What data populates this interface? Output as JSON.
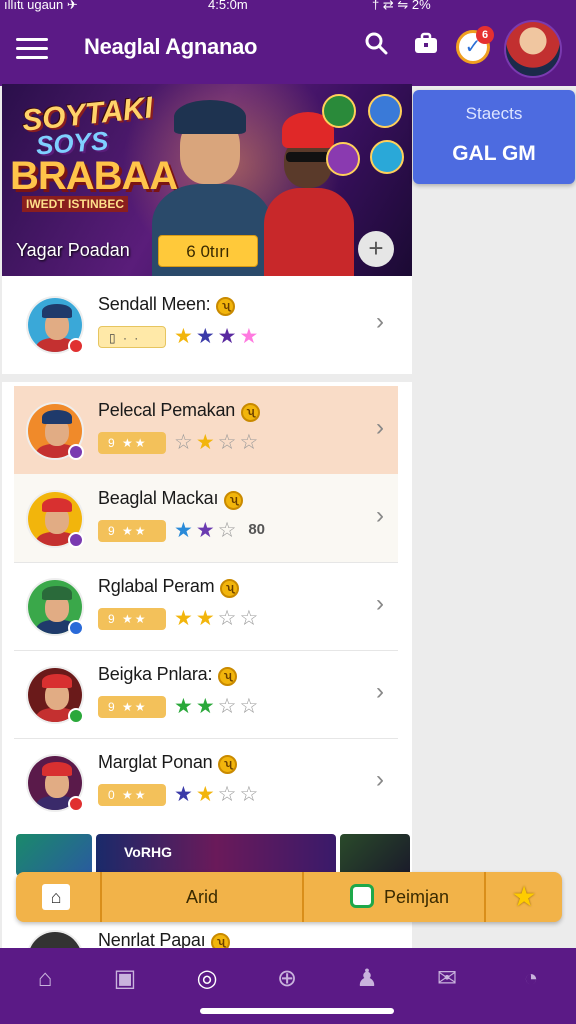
{
  "status_bar": {
    "left": "ıllıtɩ ugaun ✈",
    "time": "4:5:0m",
    "right": "† ⇄ ⇋  2%"
  },
  "header": {
    "title": "Neaglal Agnanao",
    "notification_badge": "6"
  },
  "banner": {
    "logo_line1": "SOYTAKI",
    "logo_line2": "SOYS",
    "logo_line3": "BRABAA",
    "logo_line4": "IWEDT ISTINBEC",
    "player_name": "Yagar Poadan",
    "button_label": "6 0tırı",
    "add_label": "+"
  },
  "side_panel": {
    "title": "Staects",
    "value": "GAL GM"
  },
  "players": [
    {
      "name": "Sendall Meen:",
      "pill": "▯ ·  ·",
      "stars": [
        {
          "c": "#f2b50c",
          "f": "★"
        },
        {
          "c": "#3a3aa8",
          "f": "★"
        },
        {
          "c": "#5a2aa0",
          "f": "★"
        },
        {
          "c": "#ff7ae0",
          "f": "★"
        }
      ],
      "extra": "",
      "highlight": false,
      "alt": false,
      "hat": "#1f3a6b",
      "shirt": "#c43030",
      "bg": "#3aa8d8",
      "badge": "#e03030"
    },
    {
      "name": "Pelecal Pemakan",
      "pill": "9 ★★",
      "stars": [
        {
          "c": "#999",
          "f": "☆"
        },
        {
          "c": "#f2b50c",
          "f": "★"
        },
        {
          "c": "#999",
          "f": "☆"
        },
        {
          "c": "#999",
          "f": "☆"
        }
      ],
      "extra": "",
      "highlight": true,
      "alt": false,
      "hat": "#1f3a6b",
      "shirt": "#c43030",
      "bg": "#f08a2a",
      "badge": "#7a3ab0"
    },
    {
      "name": "Beaglal Mackaı",
      "pill": "9 ★★",
      "stars": [
        {
          "c": "#2a8ad8",
          "f": "★"
        },
        {
          "c": "#6a3ab0",
          "f": "★"
        },
        {
          "c": "#999",
          "f": "☆"
        }
      ],
      "extra": "80",
      "highlight": false,
      "alt": true,
      "hat": "#d83030",
      "shirt": "#c43030",
      "bg": "#f2b50c",
      "badge": "#7a3ab0"
    },
    {
      "name": "Rglabal Peram",
      "pill": "9 ★★",
      "stars": [
        {
          "c": "#f2b50c",
          "f": "★"
        },
        {
          "c": "#f2b50c",
          "f": "★"
        },
        {
          "c": "#999",
          "f": "☆"
        },
        {
          "c": "#999",
          "f": "☆"
        }
      ],
      "extra": "",
      "highlight": false,
      "alt": false,
      "hat": "#2a6a3a",
      "shirt": "#1f3a6b",
      "bg": "#3aa84a",
      "badge": "#2a6ad8"
    },
    {
      "name": "Beigka Pnlara:",
      "pill": "9 ★★",
      "stars": [
        {
          "c": "#2aa83a",
          "f": "★"
        },
        {
          "c": "#2aa83a",
          "f": "★"
        },
        {
          "c": "#999",
          "f": "☆"
        },
        {
          "c": "#999",
          "f": "☆"
        }
      ],
      "extra": "",
      "highlight": false,
      "alt": false,
      "hat": "#d83030",
      "shirt": "#c43030",
      "bg": "#6a1a1a",
      "badge": "#2aa83a"
    },
    {
      "name": "Marglat Ponan",
      "pill": "0 ★★",
      "stars": [
        {
          "c": "#3a3aa8",
          "f": "★"
        },
        {
          "c": "#f2b50c",
          "f": "★"
        },
        {
          "c": "#999",
          "f": "☆"
        },
        {
          "c": "#999",
          "f": "☆"
        }
      ],
      "extra": "",
      "highlight": false,
      "alt": false,
      "hat": "#d83030",
      "shirt": "#3a2a6a",
      "bg": "#5a1a4a",
      "badge": "#e03030"
    }
  ],
  "thumbs": {
    "label": "VoRHG"
  },
  "last_row": {
    "name": "Nenrlat Papaı"
  },
  "actionbar": {
    "arid": "Arid",
    "peimjan": "Peimjan"
  },
  "coin_symbol": "ʯ",
  "chevron": "›",
  "accent": {
    "purple": "#5b1a86",
    "gold": "#f2b349",
    "blue": "#4d6be0"
  }
}
